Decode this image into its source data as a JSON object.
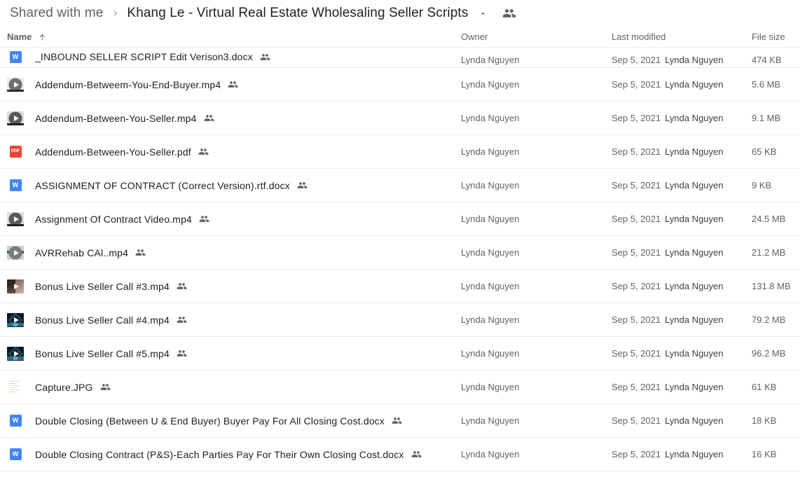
{
  "header": {
    "breadcrumb_root": "Shared with me",
    "breadcrumb_separator_icon": "chevron-right-icon",
    "current_folder": "Khang Le - Virtual Real Estate Wholesaling Seller Scripts",
    "caret_icon": "chevron-down-icon",
    "people_icon": "people-icon"
  },
  "columns": {
    "name": "Name",
    "sort_icon": "arrow-up-icon",
    "owner": "Owner",
    "last_modified": "Last modified",
    "file_size": "File size"
  },
  "colors": {
    "word_blue": "#4285f4",
    "pdf_red": "#ea4335",
    "divider": "#e8eaed",
    "text_primary": "#202124",
    "text_secondary": "#5f6368"
  },
  "files": [
    {
      "name": "_INBOUND SELLER SCRIPT Edit Verison3.docx",
      "icon": "word-doc-icon",
      "shared_icon": "shared-people-icon",
      "owner": "Lynda Nguyen",
      "modified_date": "Sep 5, 2021",
      "modified_by": "Lynda Nguyen",
      "size": "474 KB",
      "clipped": true
    },
    {
      "name": "Addendum-Betweem-You-End-Buyer.mp4",
      "icon": "video-thumbnail-icon",
      "shared_icon": "shared-people-icon",
      "owner": "Lynda Nguyen",
      "modified_date": "Sep 5, 2021",
      "modified_by": "Lynda Nguyen",
      "size": "5.6 MB",
      "clipped": false
    },
    {
      "name": "Addendum-Between-You-Seller.mp4",
      "icon": "video-thumbnail-icon",
      "shared_icon": "shared-people-icon",
      "owner": "Lynda Nguyen",
      "modified_date": "Sep 5, 2021",
      "modified_by": "Lynda Nguyen",
      "size": "9.1 MB",
      "clipped": false
    },
    {
      "name": "Addendum-Between-You-Seller.pdf",
      "icon": "pdf-icon",
      "shared_icon": "shared-people-icon",
      "owner": "Lynda Nguyen",
      "modified_date": "Sep 5, 2021",
      "modified_by": "Lynda Nguyen",
      "size": "65 KB",
      "clipped": false
    },
    {
      "name": "ASSIGNMENT OF CONTRACT (Correct Version).rtf.docx",
      "icon": "word-doc-icon",
      "shared_icon": "shared-people-icon",
      "owner": "Lynda Nguyen",
      "modified_date": "Sep 5, 2021",
      "modified_by": "Lynda Nguyen",
      "size": "9 KB",
      "clipped": false
    },
    {
      "name": "Assignment Of Contract Video.mp4",
      "icon": "video-thumbnail-icon",
      "shared_icon": "shared-people-icon",
      "owner": "Lynda Nguyen",
      "modified_date": "Sep 5, 2021",
      "modified_by": "Lynda Nguyen",
      "size": "24.5 MB",
      "clipped": false
    },
    {
      "name": "AVRRehab CAl..mp4",
      "icon": "video-thumbnail-icon",
      "shared_icon": "shared-people-icon",
      "owner": "Lynda Nguyen",
      "modified_date": "Sep 5, 2021",
      "modified_by": "Lynda Nguyen",
      "size": "21.2 MB",
      "clipped": false
    },
    {
      "name": "Bonus Live Seller Call #3.mp4",
      "icon": "video-thumbnail-icon",
      "shared_icon": "shared-people-icon",
      "owner": "Lynda Nguyen",
      "modified_date": "Sep 5, 2021",
      "modified_by": "Lynda Nguyen",
      "size": "131.8 MB",
      "clipped": false
    },
    {
      "name": "Bonus Live Seller Call #4.mp4",
      "icon": "video-thumbnail-icon",
      "shared_icon": "shared-people-icon",
      "owner": "Lynda Nguyen",
      "modified_date": "Sep 5, 2021",
      "modified_by": "Lynda Nguyen",
      "size": "79.2 MB",
      "clipped": false
    },
    {
      "name": "Bonus Live Seller Call #5.mp4",
      "icon": "video-thumbnail-icon",
      "shared_icon": "shared-people-icon",
      "owner": "Lynda Nguyen",
      "modified_date": "Sep 5, 2021",
      "modified_by": "Lynda Nguyen",
      "size": "96.2 MB",
      "clipped": false
    },
    {
      "name": "Capture.JPG",
      "icon": "image-thumbnail-icon",
      "shared_icon": "shared-people-icon",
      "owner": "Lynda Nguyen",
      "modified_date": "Sep 5, 2021",
      "modified_by": "Lynda Nguyen",
      "size": "61 KB",
      "clipped": false
    },
    {
      "name": "Double Closing (Between U & End Buyer) Buyer Pay For All Closing Cost.docx",
      "icon": "word-doc-icon",
      "shared_icon": "shared-people-icon",
      "owner": "Lynda Nguyen",
      "modified_date": "Sep 5, 2021",
      "modified_by": "Lynda Nguyen",
      "size": "18 KB",
      "clipped": false
    },
    {
      "name": "Double Closing Contract (P&S)-Each Parties Pay For Their Own Closing Cost.docx",
      "icon": "word-doc-icon",
      "shared_icon": "shared-people-icon",
      "owner": "Lynda Nguyen",
      "modified_date": "Sep 5, 2021",
      "modified_by": "Lynda Nguyen",
      "size": "16 KB",
      "clipped": false
    }
  ],
  "icon_labels": {
    "word": "W",
    "pdf": "PDF"
  }
}
